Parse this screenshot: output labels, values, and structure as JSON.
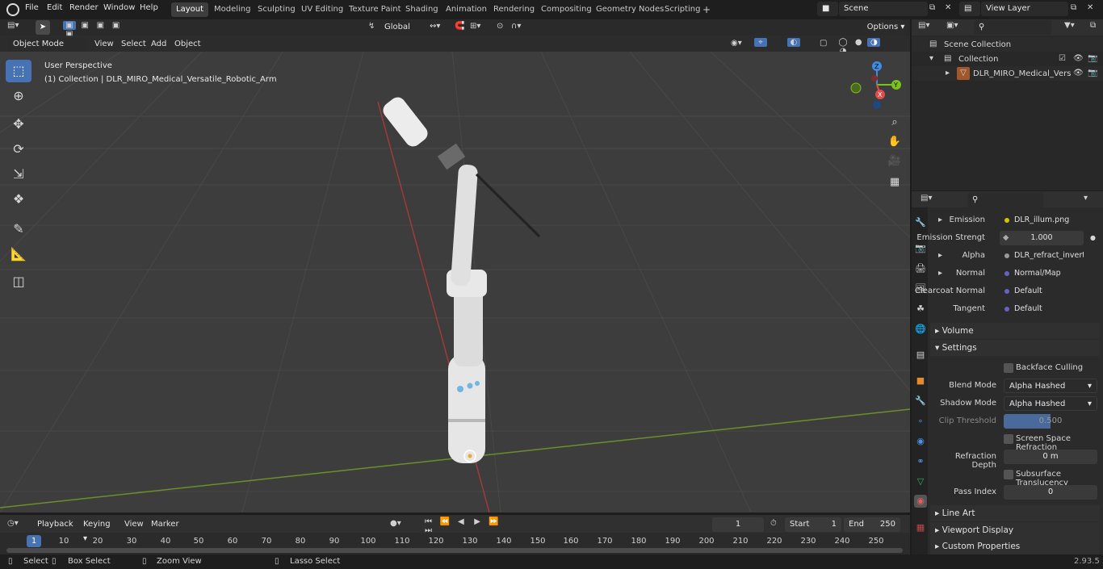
{
  "menu": {
    "file": "File",
    "edit": "Edit",
    "render": "Render",
    "window": "Window",
    "help": "Help"
  },
  "workspaces": [
    "Layout",
    "Modeling",
    "Sculpting",
    "UV Editing",
    "Texture Paint",
    "Shading",
    "Animation",
    "Rendering",
    "Compositing",
    "Geometry Nodes",
    "Scripting"
  ],
  "scene": "Scene",
  "view_layer": "View Layer",
  "viewport": {
    "mode": "Object Mode",
    "view": "View",
    "select": "Select",
    "add": "Add",
    "object": "Object",
    "transform": "Global",
    "options": "Options",
    "perspective": "User Perspective",
    "collection_info": "(1) Collection | DLR_MIRO_Medical_Versatile_Robotic_Arm"
  },
  "outliner": {
    "scene_collection": "Scene Collection",
    "collection": "Collection",
    "object": "DLR_MIRO_Medical_Vers"
  },
  "properties": {
    "rows": [
      {
        "label": "Emission",
        "value": "DLR_illum.png",
        "color": "#d6c300"
      },
      {
        "label": "Emission Strengt",
        "value": "1.000",
        "color": ""
      },
      {
        "label": "Alpha",
        "value": "DLR_refract_invert.p...",
        "color": "#9a9a9a"
      },
      {
        "label": "Normal",
        "value": "Normal/Map",
        "color": "#6363c7"
      },
      {
        "label": "Clearcoat Normal",
        "value": "Default",
        "color": "#6363c7"
      },
      {
        "label": "Tangent",
        "value": "Default",
        "color": "#6363c7"
      }
    ],
    "volume": "Volume",
    "settings": "Settings",
    "backface": "Backface Culling",
    "blend_label": "Blend Mode",
    "blend": "Alpha Hashed",
    "shadow_label": "Shadow Mode",
    "shadow": "Alpha Hashed",
    "clip_label": "Clip Threshold",
    "clip": "0.500",
    "ssr": "Screen Space Refraction",
    "refr_label": "Refraction Depth",
    "refr": "0 m",
    "sss": "Subsurface Translucency",
    "pass_label": "Pass Index",
    "pass": "0",
    "line_art": "Line Art",
    "viewport_display": "Viewport Display",
    "custom_props": "Custom Properties"
  },
  "timeline": {
    "playback": "Playback",
    "keying": "Keying",
    "view": "View",
    "marker": "Marker",
    "frame": "1",
    "start_label": "Start",
    "start": "1",
    "end_label": "End",
    "end": "250",
    "ticks": [
      "1",
      "10",
      "20",
      "30",
      "40",
      "50",
      "60",
      "70",
      "80",
      "90",
      "100",
      "110",
      "120",
      "130",
      "140",
      "150",
      "160",
      "170",
      "180",
      "190",
      "200",
      "210",
      "220",
      "230",
      "240",
      "250"
    ]
  },
  "status": {
    "select": "Select",
    "box": "Box Select",
    "zoom": "Zoom View",
    "lasso": "Lasso Select",
    "version": "2.93.5"
  },
  "colors": {
    "accent": "#4772b3",
    "x_axis": "#e44c4c",
    "y_axis": "#7cc21d",
    "z_axis": "#3d8ee3"
  }
}
